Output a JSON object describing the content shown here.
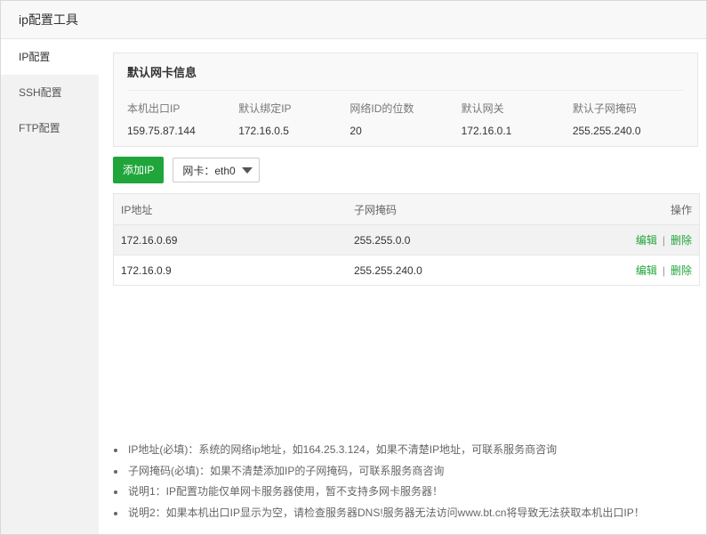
{
  "window": {
    "title": "ip配置工具"
  },
  "sidebar": {
    "items": [
      {
        "label": "IP配置",
        "active": true
      },
      {
        "label": "SSH配置",
        "active": false
      },
      {
        "label": "FTP配置",
        "active": false
      }
    ]
  },
  "nic_info": {
    "title": "默认网卡信息",
    "fields": [
      {
        "label": "本机出口IP",
        "value": "159.75.87.144"
      },
      {
        "label": "默认绑定IP",
        "value": "172.16.0.5"
      },
      {
        "label": "网络ID的位数",
        "value": "20"
      },
      {
        "label": "默认网关",
        "value": "172.16.0.1"
      },
      {
        "label": "默认子网掩码",
        "value": "255.255.240.0"
      }
    ]
  },
  "toolbar": {
    "add_button": "添加IP",
    "nic_select": "网卡：eth0"
  },
  "table": {
    "headers": [
      "IP地址",
      "子网掩码",
      "操作"
    ],
    "rows": [
      {
        "ip": "172.16.0.69",
        "mask": "255.255.0.0",
        "edit": "编辑",
        "sep": "|",
        "delete": "删除"
      },
      {
        "ip": "172.16.0.9",
        "mask": "255.255.240.0",
        "edit": "编辑",
        "sep": "|",
        "delete": "删除"
      }
    ]
  },
  "notes": [
    "IP地址(必填)：系统的网络ip地址，如164.25.3.124，如果不清楚IP地址，可联系服务商咨询",
    "子网掩码(必填)：如果不清楚添加IP的子网掩码，可联系服务商咨询",
    "说明1：IP配置功能仅单网卡服务器使用，暂不支持多网卡服务器！",
    "说明2：如果本机出口IP显示为空，请检查服务器DNS!服务器无法访问www.bt.cn将导致无法获取本机出口IP！"
  ],
  "colors": {
    "accent": "#20a53a",
    "sidebar_bg": "#f2f2f2"
  },
  "icons": {
    "close": "close-icon",
    "dropdown": "chevron-down-icon"
  }
}
